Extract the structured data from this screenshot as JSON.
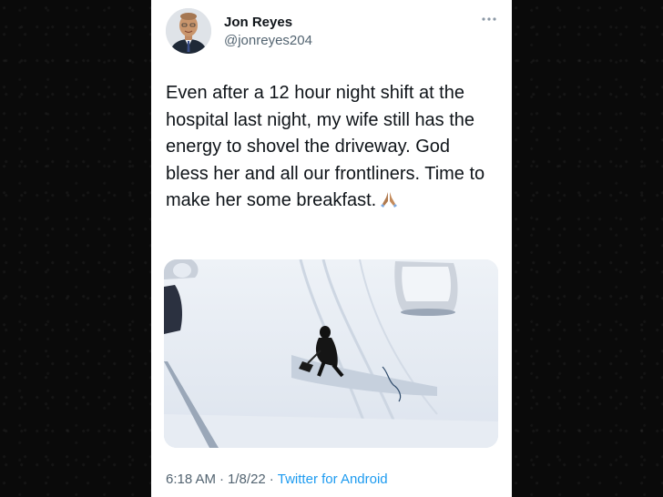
{
  "tweet": {
    "author_name": "Jon Reyes",
    "author_handle": "@jonreyes204",
    "more_icon": "more-horizontal-icon",
    "text": "Even after a 12 hour night shift at the hospital last night, my wife still has the energy to shovel the driveway. God bless her and all our frontliners. Time to make her some breakfast.",
    "emoji": "folded-hands-emoji",
    "media": {
      "kind": "photo",
      "subject": "person-shoveling-snow"
    },
    "time": "6:18 AM",
    "separator": "·",
    "date": "1/8/22",
    "source": "Twitter for Android"
  },
  "colors": {
    "text": "#0f1419",
    "secondary": "#536471",
    "link": "#1d9bf0",
    "background": "#0b0b0b",
    "card": "#ffffff"
  }
}
